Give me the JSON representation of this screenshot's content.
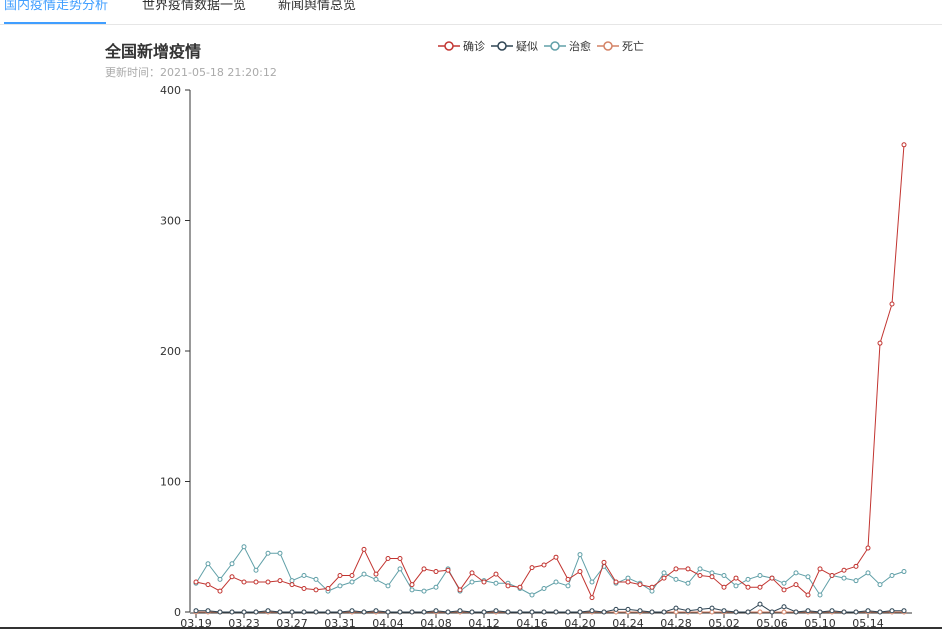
{
  "tabs": [
    "国内疫情走势分析",
    "世界疫情数据一览",
    "新闻舆情总览"
  ],
  "chart_data": {
    "type": "line",
    "title": "全国新增疫情",
    "subtitle": "更新时间：2021-05-18 21:20:12",
    "ylim": [
      0,
      400
    ],
    "yticks": [
      0,
      100,
      200,
      300,
      400
    ],
    "x": [
      "03.19",
      "03.20",
      "03.21",
      "03.22",
      "03.23",
      "03.24",
      "03.25",
      "03.26",
      "03.27",
      "03.28",
      "03.29",
      "03.30",
      "03.31",
      "04.01",
      "04.02",
      "04.03",
      "04.04",
      "04.05",
      "04.06",
      "04.07",
      "04.08",
      "04.09",
      "04.10",
      "04.11",
      "04.12",
      "04.13",
      "04.14",
      "04.15",
      "04.16",
      "04.17",
      "04.18",
      "04.19",
      "04.20",
      "04.21",
      "04.22",
      "04.23",
      "04.24",
      "04.25",
      "04.26",
      "04.27",
      "04.28",
      "04.29",
      "04.30",
      "05.01",
      "05.02",
      "05.03",
      "05.04",
      "05.05",
      "05.06",
      "05.07",
      "05.08",
      "05.09",
      "05.10",
      "05.11",
      "05.12",
      "05.13",
      "05.14",
      "05.15",
      "05.16",
      "05.17"
    ],
    "xtick_labels": [
      "03.19",
      "03.23",
      "03.27",
      "03.31",
      "04.04",
      "04.08",
      "04.12",
      "04.16",
      "04.20",
      "04.24",
      "04.28",
      "05.02",
      "05.06",
      "05.10",
      "05.14"
    ],
    "legend_position": "top-center",
    "grid": false,
    "series": [
      {
        "name": "确诊",
        "color": "#c23531",
        "values": [
          23,
          21,
          16,
          27,
          23,
          23,
          23,
          24,
          21,
          18,
          17,
          18,
          28,
          28,
          48,
          29,
          41,
          41,
          21,
          33,
          31,
          32,
          17,
          30,
          23,
          29,
          20,
          19,
          34,
          36,
          42,
          25,
          31,
          11,
          38,
          23,
          23,
          21,
          19,
          26,
          33,
          33,
          28,
          27,
          19,
          26,
          19,
          19,
          26,
          17,
          21,
          13,
          33,
          28,
          32,
          35,
          49,
          206,
          236,
          358
        ]
      },
      {
        "name": "疑似",
        "color": "#2f4554",
        "values": [
          1,
          1,
          0,
          0,
          0,
          0,
          1,
          0,
          0,
          0,
          0,
          0,
          0,
          1,
          0,
          1,
          0,
          0,
          0,
          0,
          1,
          0,
          1,
          0,
          0,
          1,
          0,
          0,
          0,
          0,
          0,
          0,
          0,
          1,
          0,
          2,
          2,
          1,
          0,
          0,
          3,
          1,
          2,
          3,
          1,
          0,
          0,
          6,
          0,
          4,
          0,
          1,
          0,
          1,
          0,
          0,
          1,
          0,
          1,
          1
        ]
      },
      {
        "name": "治愈",
        "color": "#61a0a8",
        "values": [
          22,
          37,
          25,
          37,
          50,
          32,
          45,
          45,
          24,
          28,
          25,
          16,
          20,
          23,
          29,
          25,
          20,
          33,
          17,
          16,
          19,
          33,
          16,
          23,
          24,
          22,
          22,
          18,
          13,
          18,
          23,
          20,
          44,
          23,
          35,
          22,
          26,
          22,
          16,
          30,
          25,
          22,
          33,
          30,
          28,
          20,
          25,
          28,
          26,
          22,
          30,
          27,
          13,
          28,
          26,
          24,
          30,
          21,
          28,
          31
        ]
      },
      {
        "name": "死亡",
        "color": "#d48265",
        "values": [
          0,
          0,
          0,
          0,
          0,
          0,
          0,
          0,
          0,
          0,
          0,
          0,
          0,
          0,
          0,
          0,
          0,
          0,
          0,
          0,
          0,
          0,
          0,
          0,
          0,
          0,
          0,
          0,
          0,
          0,
          0,
          0,
          0,
          0,
          0,
          0,
          0,
          0,
          0,
          0,
          0,
          0,
          0,
          0,
          0,
          0,
          0,
          0,
          0,
          0,
          0,
          0,
          0,
          0,
          0,
          0,
          0,
          0,
          0,
          0
        ]
      }
    ]
  }
}
